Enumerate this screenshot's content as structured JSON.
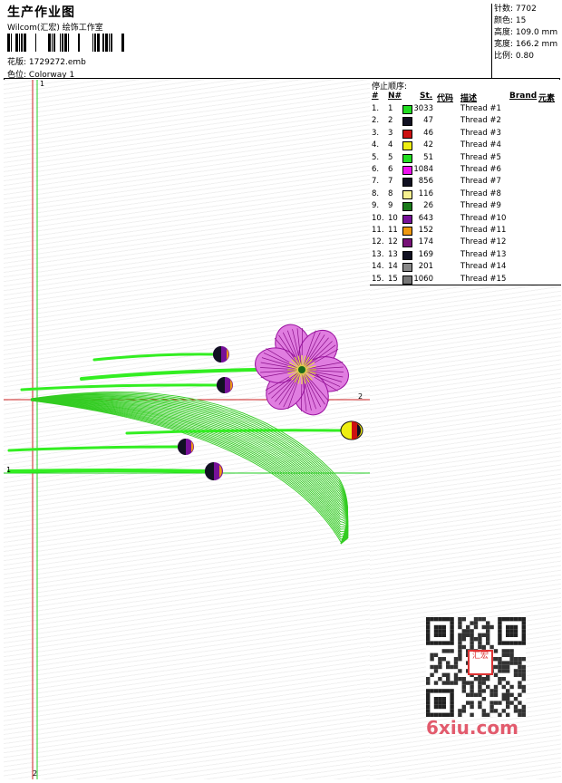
{
  "header": {
    "title": "生产作业图",
    "company": "Wilcom(汇宏) 绘饰工作室",
    "pattern_label": "花版:",
    "pattern_value": "1729272.emb",
    "colorway_label": "色位:",
    "colorway_value": "Colorway 1"
  },
  "info": [
    {
      "label": "针数:",
      "value": "7702"
    },
    {
      "label": "颜色:",
      "value": "15"
    },
    {
      "label": "高度:",
      "value": "109.0 mm"
    },
    {
      "label": "宽度:",
      "value": "166.2 mm"
    },
    {
      "label": "比例:",
      "value": "0.80"
    }
  ],
  "sequence": {
    "title": "停止顺序:",
    "columns": [
      "#",
      "N#",
      "St.",
      "代码",
      "描述",
      "Brand",
      "元素"
    ],
    "rows": [
      {
        "n": "1.",
        "num": "1",
        "color": "#22dd22",
        "st": "3033",
        "desc": "Thread #1"
      },
      {
        "n": "2.",
        "num": "2",
        "color": "#111122",
        "st": "47",
        "desc": "Thread #2"
      },
      {
        "n": "3.",
        "num": "3",
        "color": "#cc1111",
        "st": "46",
        "desc": "Thread #3"
      },
      {
        "n": "4.",
        "num": "4",
        "color": "#eeee11",
        "st": "42",
        "desc": "Thread #4"
      },
      {
        "n": "5.",
        "num": "5",
        "color": "#22dd22",
        "st": "51",
        "desc": "Thread #5"
      },
      {
        "n": "6.",
        "num": "6",
        "color": "#ee11ee",
        "st": "1084",
        "desc": "Thread #6"
      },
      {
        "n": "7.",
        "num": "7",
        "color": "#111122",
        "st": "856",
        "desc": "Thread #7"
      },
      {
        "n": "8.",
        "num": "8",
        "color": "#f5f090",
        "st": "116",
        "desc": "Thread #8"
      },
      {
        "n": "9.",
        "num": "9",
        "color": "#1a7a1a",
        "st": "26",
        "desc": "Thread #9"
      },
      {
        "n": "10.",
        "num": "10",
        "color": "#771199",
        "st": "643",
        "desc": "Thread #10"
      },
      {
        "n": "11.",
        "num": "11",
        "color": "#ee9911",
        "st": "152",
        "desc": "Thread #11"
      },
      {
        "n": "12.",
        "num": "12",
        "color": "#771177",
        "st": "174",
        "desc": "Thread #12"
      },
      {
        "n": "13.",
        "num": "13",
        "color": "#111122",
        "st": "169",
        "desc": "Thread #13"
      },
      {
        "n": "14.",
        "num": "14",
        "color": "#888888",
        "st": "201",
        "desc": "Thread #14"
      },
      {
        "n": "15.",
        "num": "15",
        "color": "#777777",
        "st": "1060",
        "desc": "Thread #15"
      }
    ]
  },
  "markers": {
    "v_top": "1",
    "v_bottom": "2",
    "h_upper": "2",
    "h_lower": "1"
  },
  "watermark": {
    "site": "6xiu.com",
    "seal": "汇宏"
  }
}
